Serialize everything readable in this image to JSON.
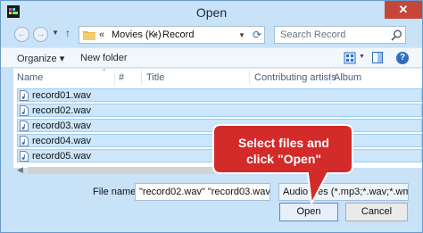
{
  "window": {
    "title": "Open",
    "close_label": "✕"
  },
  "address": {
    "path_prefix": "«",
    "crumbs": [
      "Movies (K:)",
      "Record"
    ],
    "search_placeholder": "Search Record"
  },
  "toolbar": {
    "organize_label": "Organize ▾",
    "new_folder_label": "New folder",
    "help_label": "?"
  },
  "columns": [
    "Name",
    "#",
    "Title",
    "Contributing artists",
    "Album"
  ],
  "files": [
    {
      "name": "record01.wav"
    },
    {
      "name": "record02.wav"
    },
    {
      "name": "record03.wav"
    },
    {
      "name": "record04.wav"
    },
    {
      "name": "record05.wav"
    }
  ],
  "bottom": {
    "filename_label": "File name:",
    "filename_value": "\"record02.wav\" \"record03.wav\" \"re",
    "filetype_value": "Audio files (*.mp3;*.wav;*.wma",
    "open_label": "Open",
    "cancel_label": "Cancel"
  },
  "callout": {
    "line1": "Select files and",
    "line2": "click \"Open\""
  },
  "colors": {
    "window_frame": "#c8e2f8",
    "selection": "#cce6fb",
    "callout_red": "#d32a2a"
  }
}
